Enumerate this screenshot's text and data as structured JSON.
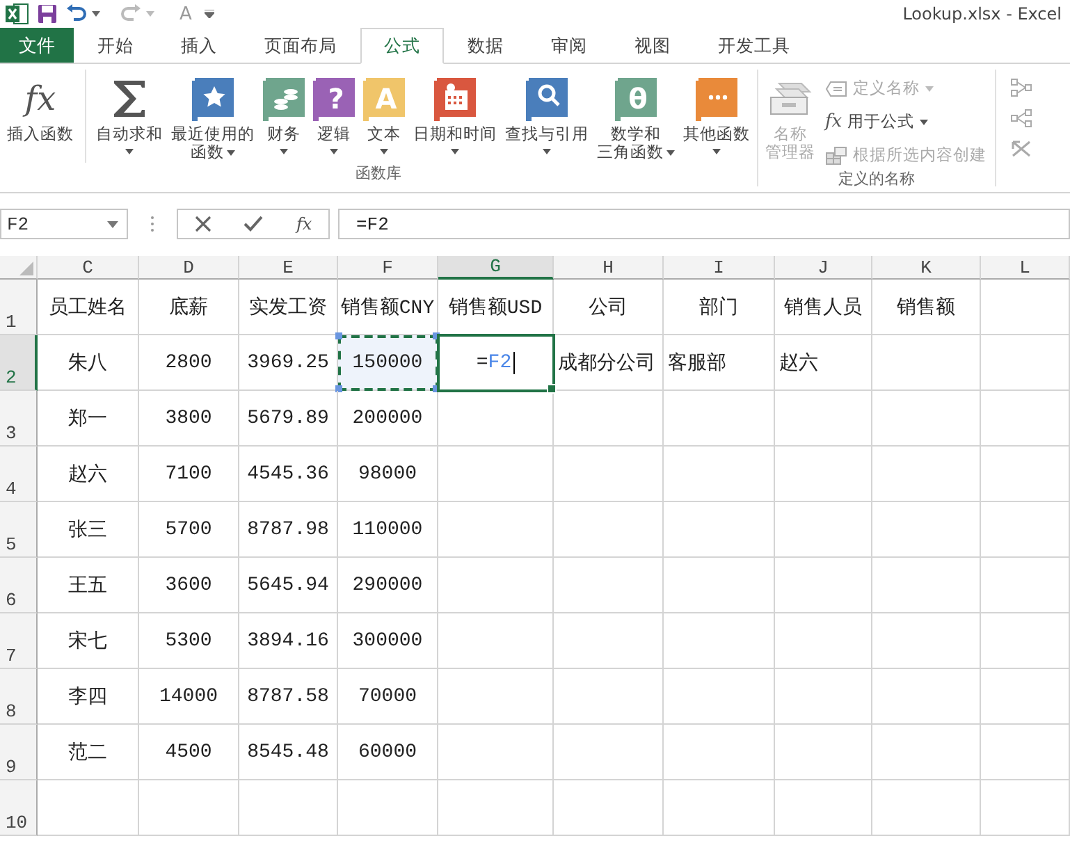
{
  "window": {
    "title": "Lookup.xlsx - Excel"
  },
  "quick_access": {
    "font_glyph": "A"
  },
  "tabs": [
    {
      "label": "文件",
      "kind": "file",
      "selected": false
    },
    {
      "label": "开始",
      "kind": "tab",
      "selected": false
    },
    {
      "label": "插入",
      "kind": "tab",
      "selected": false
    },
    {
      "label": "页面布局",
      "kind": "tab",
      "selected": false
    },
    {
      "label": "公式",
      "kind": "tab",
      "selected": true
    },
    {
      "label": "数据",
      "kind": "tab",
      "selected": false
    },
    {
      "label": "审阅",
      "kind": "tab",
      "selected": false
    },
    {
      "label": "视图",
      "kind": "tab",
      "selected": false
    },
    {
      "label": "开发工具",
      "kind": "tab",
      "selected": false
    }
  ],
  "ribbon": {
    "groups": [
      {
        "label": "函数库",
        "items": [
          {
            "kind": "large",
            "glyph": "fx",
            "lines": [
              "插入函数"
            ],
            "caret": false,
            "disabled": false
          },
          {
            "kind": "large",
            "lines": [
              "自动求和"
            ],
            "caret": true,
            "disabled": false
          },
          {
            "kind": "large",
            "lines": [
              "最近使用的",
              "函数"
            ],
            "caret": true,
            "disabled": false
          },
          {
            "kind": "large",
            "lines": [
              "财务"
            ],
            "caret": true,
            "disabled": false
          },
          {
            "kind": "large",
            "glyph": "?",
            "lines": [
              "逻辑"
            ],
            "caret": true,
            "disabled": false
          },
          {
            "kind": "large",
            "glyph": "A",
            "lines": [
              "文本"
            ],
            "caret": true,
            "disabled": false
          },
          {
            "kind": "large",
            "lines": [
              "日期和时间"
            ],
            "caret": true,
            "disabled": false
          },
          {
            "kind": "large",
            "lines": [
              "查找与引用"
            ],
            "caret": true,
            "disabled": false
          },
          {
            "kind": "large",
            "glyph": "θ",
            "lines": [
              "数学和",
              "三角函数"
            ],
            "caret": true,
            "disabled": false
          },
          {
            "kind": "large",
            "lines": [
              "其他函数"
            ],
            "caret": true,
            "disabled": false
          }
        ]
      },
      {
        "label": "定义的名称",
        "items": [
          {
            "kind": "large",
            "lines": [
              "名称",
              "管理器"
            ],
            "caret": false,
            "disabled": true
          },
          {
            "kind": "stack",
            "entries": [
              {
                "label": "定义名称",
                "caret": true,
                "disabled": true
              },
              {
                "glyph": "fx",
                "label": "用于公式",
                "caret": true,
                "disabled": false
              },
              {
                "label": "根据所选内容创建",
                "caret": false,
                "disabled": true
              }
            ]
          }
        ]
      }
    ]
  },
  "formula_bar": {
    "name_box": "F2",
    "fx": "fx",
    "formula": "=F2"
  },
  "sheet": {
    "columns": [
      {
        "letter": "C",
        "selected": false
      },
      {
        "letter": "D",
        "selected": false
      },
      {
        "letter": "E",
        "selected": false
      },
      {
        "letter": "F",
        "selected": false
      },
      {
        "letter": "G",
        "selected": true
      },
      {
        "letter": "H",
        "selected": false
      },
      {
        "letter": "I",
        "selected": false
      },
      {
        "letter": "J",
        "selected": false
      },
      {
        "letter": "K",
        "selected": false
      },
      {
        "letter": "L",
        "selected": false
      }
    ],
    "rows": [
      {
        "number": "1",
        "selected": false,
        "cells": [
          {
            "kind": "center",
            "text": "员工姓名"
          },
          {
            "kind": "center",
            "text": "底薪"
          },
          {
            "kind": "center",
            "text": "实发工资"
          },
          {
            "kind": "center",
            "text": "销售额CNY"
          },
          {
            "kind": "center",
            "text": "销售额USD"
          },
          {
            "kind": "center",
            "text": "公司"
          },
          {
            "kind": "center",
            "text": "部门"
          },
          {
            "kind": "center",
            "text": "销售人员"
          },
          {
            "kind": "center",
            "text": "销售额"
          },
          {
            "kind": "empty"
          }
        ]
      },
      {
        "number": "2",
        "selected": true,
        "cells": [
          {
            "kind": "center",
            "text": "朱八"
          },
          {
            "kind": "center",
            "text": "2800"
          },
          {
            "kind": "center",
            "text": "3969.25"
          },
          {
            "kind": "marquee",
            "text": "150000"
          },
          {
            "kind": "editing",
            "sign": "=",
            "ref": "F2"
          },
          {
            "kind": "left",
            "text": "成都分公司"
          },
          {
            "kind": "left",
            "text": "客服部"
          },
          {
            "kind": "left",
            "text": "赵六"
          },
          {
            "kind": "empty"
          },
          {
            "kind": "empty"
          }
        ]
      },
      {
        "number": "3",
        "selected": false,
        "cells": [
          {
            "kind": "center",
            "text": "郑一"
          },
          {
            "kind": "center",
            "text": "3800"
          },
          {
            "kind": "center",
            "text": "5679.89"
          },
          {
            "kind": "center",
            "text": "200000"
          },
          {
            "kind": "empty"
          },
          {
            "kind": "empty"
          },
          {
            "kind": "empty"
          },
          {
            "kind": "empty"
          },
          {
            "kind": "empty"
          },
          {
            "kind": "empty"
          }
        ]
      },
      {
        "number": "4",
        "selected": false,
        "cells": [
          {
            "kind": "center",
            "text": "赵六"
          },
          {
            "kind": "center",
            "text": "7100"
          },
          {
            "kind": "center",
            "text": "4545.36"
          },
          {
            "kind": "center",
            "text": "98000"
          },
          {
            "kind": "empty"
          },
          {
            "kind": "empty"
          },
          {
            "kind": "empty"
          },
          {
            "kind": "empty"
          },
          {
            "kind": "empty"
          },
          {
            "kind": "empty"
          }
        ]
      },
      {
        "number": "5",
        "selected": false,
        "cells": [
          {
            "kind": "center",
            "text": "张三"
          },
          {
            "kind": "center",
            "text": "5700"
          },
          {
            "kind": "center",
            "text": "8787.98"
          },
          {
            "kind": "center",
            "text": "110000"
          },
          {
            "kind": "empty"
          },
          {
            "kind": "empty"
          },
          {
            "kind": "empty"
          },
          {
            "kind": "empty"
          },
          {
            "kind": "empty"
          },
          {
            "kind": "empty"
          }
        ]
      },
      {
        "number": "6",
        "selected": false,
        "cells": [
          {
            "kind": "center",
            "text": "王五"
          },
          {
            "kind": "center",
            "text": "3600"
          },
          {
            "kind": "center",
            "text": "5645.94"
          },
          {
            "kind": "center",
            "text": "290000"
          },
          {
            "kind": "empty"
          },
          {
            "kind": "empty"
          },
          {
            "kind": "empty"
          },
          {
            "kind": "empty"
          },
          {
            "kind": "empty"
          },
          {
            "kind": "empty"
          }
        ]
      },
      {
        "number": "7",
        "selected": false,
        "cells": [
          {
            "kind": "center",
            "text": "宋七"
          },
          {
            "kind": "center",
            "text": "5300"
          },
          {
            "kind": "center",
            "text": "3894.16"
          },
          {
            "kind": "center",
            "text": "300000"
          },
          {
            "kind": "empty"
          },
          {
            "kind": "empty"
          },
          {
            "kind": "empty"
          },
          {
            "kind": "empty"
          },
          {
            "kind": "empty"
          },
          {
            "kind": "empty"
          }
        ]
      },
      {
        "number": "8",
        "selected": false,
        "cells": [
          {
            "kind": "center",
            "text": "李四"
          },
          {
            "kind": "center",
            "text": "14000"
          },
          {
            "kind": "center",
            "text": "8787.58"
          },
          {
            "kind": "center",
            "text": "70000"
          },
          {
            "kind": "empty"
          },
          {
            "kind": "empty"
          },
          {
            "kind": "empty"
          },
          {
            "kind": "empty"
          },
          {
            "kind": "empty"
          },
          {
            "kind": "empty"
          }
        ]
      },
      {
        "number": "9",
        "selected": false,
        "cells": [
          {
            "kind": "center",
            "text": "范二"
          },
          {
            "kind": "center",
            "text": "4500"
          },
          {
            "kind": "center",
            "text": "8545.48"
          },
          {
            "kind": "center",
            "text": "60000"
          },
          {
            "kind": "empty"
          },
          {
            "kind": "empty"
          },
          {
            "kind": "empty"
          },
          {
            "kind": "empty"
          },
          {
            "kind": "empty"
          },
          {
            "kind": "empty"
          }
        ]
      },
      {
        "number": "10",
        "selected": false,
        "cells": [
          {
            "kind": "empty"
          },
          {
            "kind": "empty"
          },
          {
            "kind": "empty"
          },
          {
            "kind": "empty"
          },
          {
            "kind": "empty"
          },
          {
            "kind": "empty"
          },
          {
            "kind": "empty"
          },
          {
            "kind": "empty"
          },
          {
            "kind": "empty"
          },
          {
            "kind": "empty"
          }
        ]
      }
    ]
  }
}
